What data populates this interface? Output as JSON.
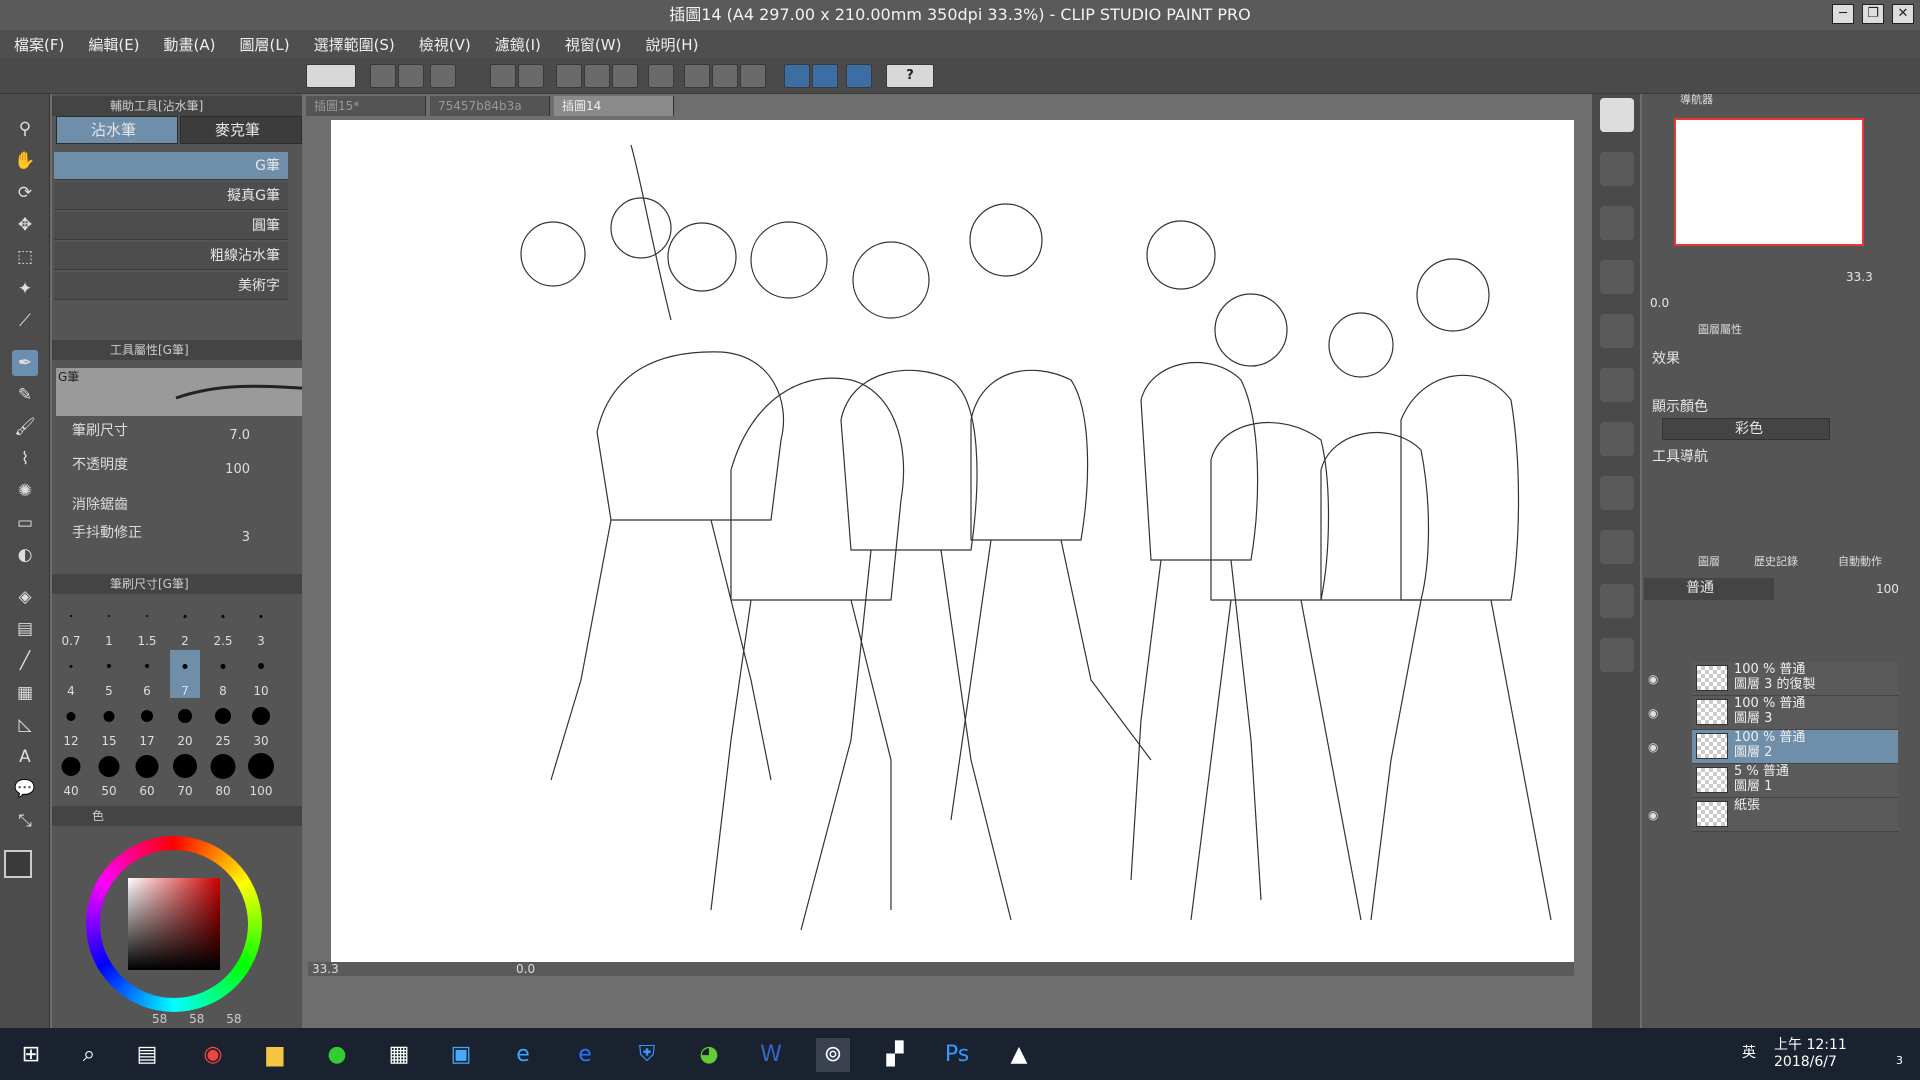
{
  "app": {
    "title": "插圖14 (A4 297.00 x 210.00mm 350dpi 33.3%) - CLIP STUDIO PAINT PRO"
  },
  "menu": [
    "檔案(F)",
    "編輯(E)",
    "動畫(A)",
    "圖層(L)",
    "選擇範圍(S)",
    "檢視(V)",
    "濾鏡(I)",
    "視窗(W)",
    "說明(H)"
  ],
  "subtool_panel": {
    "title": "輔助工具[沾水筆]",
    "tab1": "沾水筆",
    "tab2": "麥克筆",
    "brushes": [
      "G筆",
      "擬真G筆",
      "圓筆",
      "粗線沾水筆",
      "美術字"
    ]
  },
  "tool_property": {
    "title": "工具屬性[G筆]",
    "preview_label": "G筆",
    "brush_size_label": "筆刷尺寸",
    "brush_size": "7.0",
    "opacity_label": "不透明度",
    "opacity": "100",
    "antialias_label": "消除鋸齒",
    "stabilization_label": "手抖動修正",
    "stabilization": "3"
  },
  "brush_size_panel": {
    "title": "筆刷尺寸[G筆]",
    "sizes": [
      "0.7",
      "1",
      "1.5",
      "2",
      "2.5",
      "3",
      "4",
      "5",
      "6",
      "7",
      "8",
      "10",
      "12",
      "15",
      "17",
      "20",
      "25",
      "30",
      "40",
      "50",
      "60",
      "70",
      "80",
      "100"
    ],
    "selected": "7"
  },
  "color_panel": {
    "tab": "色",
    "r": "58",
    "g": "58",
    "b": "58",
    "main_color": "#3a3a3a",
    "sub_color": "#ffffff"
  },
  "doc_tabs": [
    "插圖15*",
    "75457b84b3a",
    "插圖14"
  ],
  "status": {
    "zoom": "33.3",
    "angle": "0.0"
  },
  "navigator": {
    "tab": "導航器",
    "zoom": "33.3",
    "angle": "0.0"
  },
  "layer_property": {
    "tab": "圖層屬性",
    "effect_label": "效果",
    "display_color_label": "顯示顏色",
    "display_color": "彩色",
    "tool_nav_label": "工具導航"
  },
  "layers_panel": {
    "tab_layer": "圖層",
    "tab_history": "歷史記錄",
    "tab_auto": "自動動作",
    "blend": "普通",
    "opacity": "100",
    "layers": [
      {
        "mode": "100 % 普通",
        "name": "圖層 3 的復製",
        "visible": true
      },
      {
        "mode": "100 % 普通",
        "name": "圖層 3",
        "visible": true
      },
      {
        "mode": "100 % 普通",
        "name": "圖層 2",
        "visible": true,
        "active": true
      },
      {
        "mode": "5 % 普通",
        "name": "圖層 1",
        "visible": false
      },
      {
        "mode": "",
        "name": "紙張",
        "visible": true
      }
    ]
  },
  "taskbar": {
    "time": "上午 12:11",
    "date": "2018/6/7",
    "ime": "英",
    "notifications": "3"
  },
  "colors": {
    "accent": "#6f8eaa",
    "selection": "#3d6ea3"
  }
}
